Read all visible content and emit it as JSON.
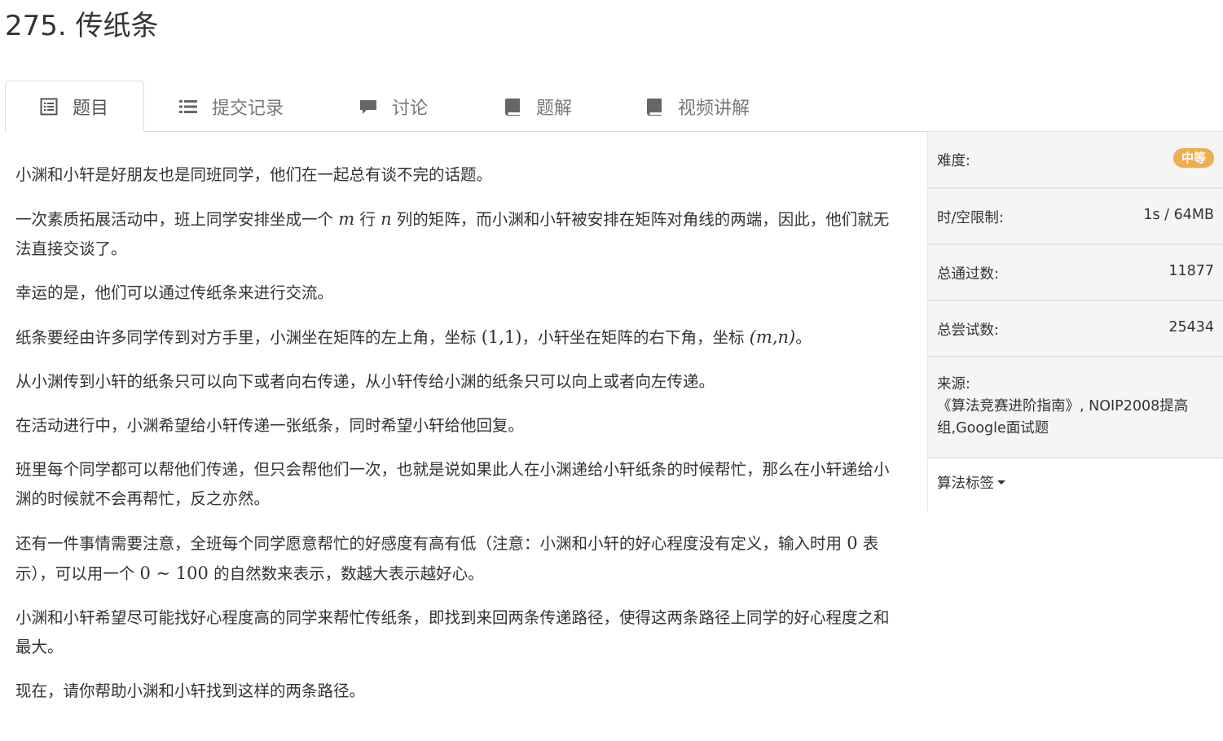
{
  "problem": {
    "title": "275. 传纸条"
  },
  "tabs": [
    {
      "label": "题目",
      "icon": "list-alt-icon",
      "active": true
    },
    {
      "label": "提交记录",
      "icon": "list-icon"
    },
    {
      "label": "讨论",
      "icon": "comment-icon"
    },
    {
      "label": "题解",
      "icon": "book-icon"
    },
    {
      "label": "视频讲解",
      "icon": "book-icon"
    }
  ],
  "description": {
    "p1": "小渊和小轩是好朋友也是同班同学，他们在一起总有谈不完的话题。",
    "p2a": "一次素质拓展活动中，班上同学安排坐成一个",
    "p2m": "m",
    "p2b": "行",
    "p2n": "n",
    "p2c": "列的矩阵，而小渊和小轩被安排在矩阵对角线的两端，因此，他们就无法直接交谈了。",
    "p3": "幸运的是，他们可以通过传纸条来进行交流。",
    "p4a": "纸条要经由许多同学传到对方手里，小渊坐在矩阵的左上角，坐标",
    "p4m1": "(1,1)",
    "p4b": "，小轩坐在矩阵的右下角，坐标",
    "p4m2": "(m,n)",
    "p4c": "。",
    "p5": "从小渊传到小轩的纸条只可以向下或者向右传递，从小轩传给小渊的纸条只可以向上或者向左传递。",
    "p6": "在活动进行中，小渊希望给小轩传递一张纸条，同时希望小轩给他回复。",
    "p7": "班里每个同学都可以帮他们传递，但只会帮他们一次，也就是说如果此人在小渊递给小轩纸条的时候帮忙，那么在小轩递给小渊的时候就不会再帮忙，反之亦然。",
    "p8a": "还有一件事情需要注意，全班每个同学愿意帮忙的好感度有高有低（注意：小渊和小轩的好心程度没有定义，输入时用",
    "p8m1": "0",
    "p8b": "表示），可以用一个",
    "p8m2": "0 ∼ 100",
    "p8c": "的自然数来表示，数越大表示越好心。",
    "p9": "小渊和小轩希望尽可能找好心程度高的同学来帮忙传纸条，即找到来回两条传递路径，使得这两条路径上同学的好心程度之和最大。",
    "p10": "现在，请你帮助小渊和小轩找到这样的两条路径。"
  },
  "sidebar": {
    "difficulty_label": "难度:",
    "difficulty_value": "中等",
    "difficulty_color": "#f0ad4e",
    "limit_label": "时/空限制:",
    "limit_value": "1s / 64MB",
    "passed_label": "总通过数:",
    "passed_value": "11877",
    "tried_label": "总尝试数:",
    "tried_value": "25434",
    "source_label": "来源:",
    "source_value": "《算法竞赛进阶指南》, NOIP2008提高组,Google面试题",
    "tags_label": "算法标签"
  }
}
